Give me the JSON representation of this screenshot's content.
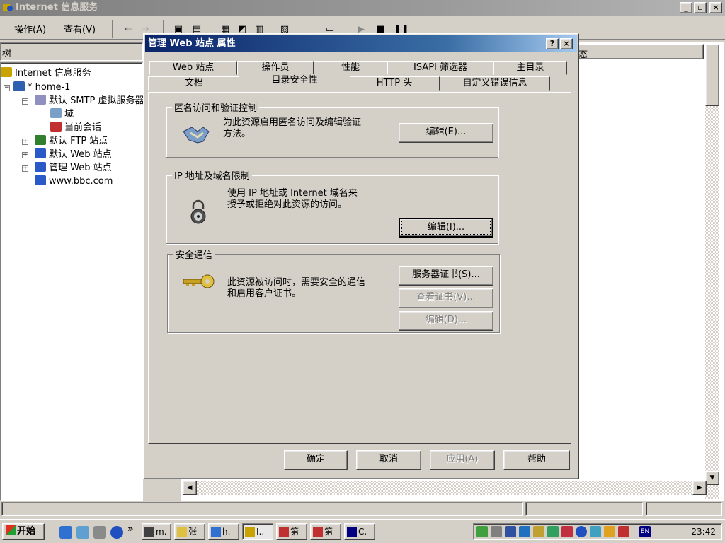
{
  "main_window": {
    "title": "Internet 信息服务",
    "menu": [
      "操作(A)",
      "查看(V)"
    ],
    "tree_header": "树",
    "column_header": "态",
    "tree": [
      {
        "label": "Internet 信息服务"
      },
      {
        "label": "* home-1"
      },
      {
        "label": "默认 SMTP 虚拟服务器"
      },
      {
        "label": "域"
      },
      {
        "label": "当前会话"
      },
      {
        "label": "默认 FTP 站点"
      },
      {
        "label": "默认 Web 站点"
      },
      {
        "label": "管理 Web 站点"
      },
      {
        "label": "www.bbc.com"
      }
    ]
  },
  "dialog": {
    "title": "管理 Web 站点 属性",
    "help_btn": "?",
    "close_btn": "×",
    "tabs_row1": [
      "Web 站点",
      "操作员",
      "性能",
      "ISAPI 筛选器",
      "主目录"
    ],
    "tabs_row2": [
      "文档",
      "目录安全性",
      "HTTP 头",
      "自定义错误信息"
    ],
    "active_tab": "目录安全性",
    "anon_group": {
      "title": "匿名访问和验证控制",
      "text_line1": "为此资源启用匿名访问及编辑验证",
      "text_line2": "方法。",
      "edit_btn": "编辑(E)..."
    },
    "ip_group": {
      "title": "IP 地址及域名限制",
      "text_line1": "使用 IP 地址或 Internet 域名来",
      "text_line2": "授予或拒绝对此资源的访问。",
      "edit_btn": "编辑(I)..."
    },
    "secure_group": {
      "title": "安全通信",
      "text_line1": "此资源被访问时，需要安全的通信",
      "text_line2": "和启用客户证书。",
      "server_cert_btn": "服务器证书(S)...",
      "view_cert_btn": "查看证书(V)...",
      "edit_btn": "编辑(D)..."
    },
    "footer": {
      "ok": "确定",
      "cancel": "取消",
      "apply": "应用(A)",
      "help": "帮助"
    }
  },
  "taskbar": {
    "start": "开始",
    "quick_launch_more": "»",
    "tasks": [
      "m.",
      "张",
      "h.",
      "I..",
      "第",
      "第",
      "C."
    ],
    "clock": "23:42",
    "ime": "EN"
  },
  "colors": {
    "active_title_start": "#0a246a",
    "active_title_end": "#a6caf0",
    "inactive_title": "#808080",
    "face": "#d4d0c8"
  }
}
